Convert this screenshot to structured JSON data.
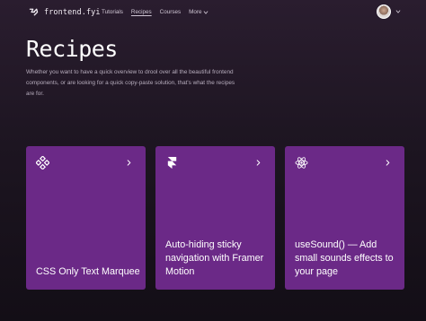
{
  "nav": {
    "logo_text": "frontend.fyi",
    "links": [
      "Tutorials",
      "Recipes",
      "Courses"
    ],
    "more_label": "More"
  },
  "hero": {
    "title": "Recipes",
    "description": "Whether you want to have a quick overview to drool over all the beautiful frontend components, or are looking for a quick copy-paste solution, that's what the recipes are for."
  },
  "cards": [
    {
      "title": "CSS Only Text Marquee",
      "icon": "diamond-grid-icon"
    },
    {
      "title": "Auto-hiding sticky navigation with Framer Motion",
      "icon": "framer-icon"
    },
    {
      "title": "useSound() — Add small sounds effects to your page",
      "icon": "react-icon"
    }
  ],
  "colors": {
    "card_bg": "#6b2987",
    "page_bg": "#1d1521"
  }
}
